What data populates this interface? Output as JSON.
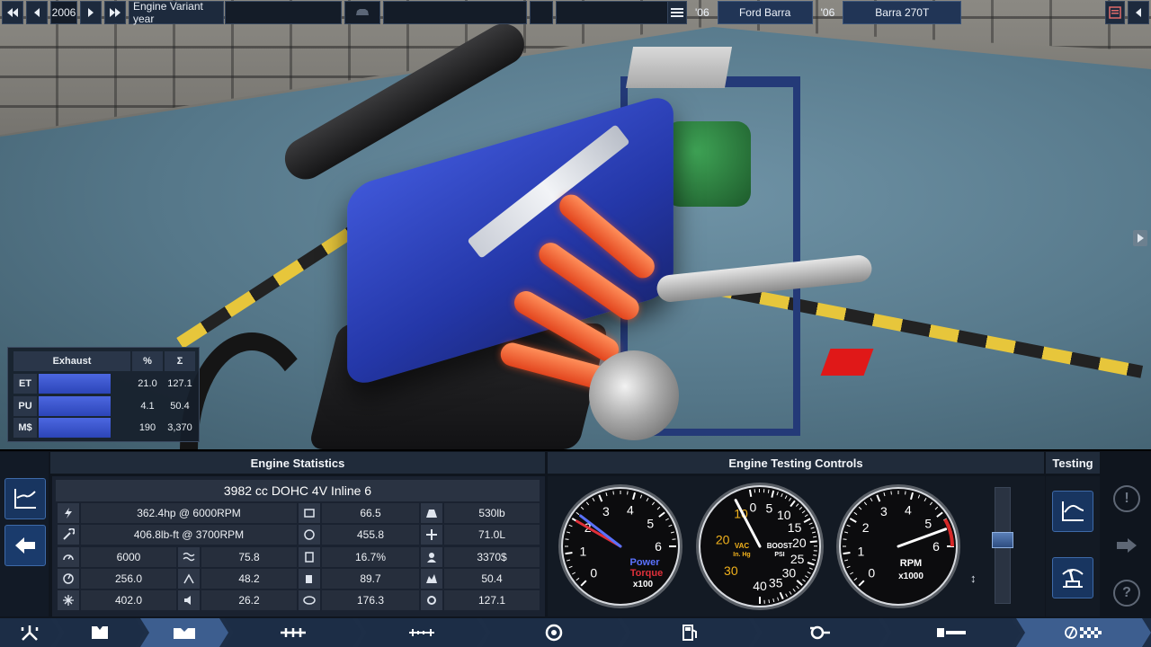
{
  "topbar": {
    "year": "2006",
    "label": "Engine Variant year",
    "model_year": "'06",
    "model_name": "Ford Barra",
    "variant_year": "'06",
    "variant_name": "Barra 270T",
    "icons": [
      "first-icon",
      "prev-icon",
      "next-icon",
      "last-icon",
      "car-icon",
      "list-icon",
      "menu-icon"
    ]
  },
  "exhaust": {
    "title": "Exhaust",
    "col_pct": "%",
    "col_sum": "Σ",
    "rows": [
      {
        "label": "ET",
        "pct": "21.0",
        "sum": "127.1",
        "fill": 1.0
      },
      {
        "label": "PU",
        "pct": "4.1",
        "sum": "50.4",
        "fill": 1.0
      },
      {
        "label": "M$",
        "pct": "190",
        "sum": "3,370",
        "fill": 1.0
      }
    ]
  },
  "stats": {
    "title": "Engine Statistics",
    "engine_desc": "3982 cc DOHC 4V  Inline 6",
    "power": "362.4hp @ 6000RPM",
    "torque": "406.8lb-ft @ 3700RPM",
    "r1": {
      "c1": "66.5",
      "c2": "530lb"
    },
    "r2": {
      "c1": "455.8",
      "c2": "71.0L"
    },
    "r3": {
      "a": "6000",
      "b": "75.8",
      "c1": "16.7%",
      "c2": "3370$"
    },
    "r4": {
      "a": "256.0",
      "b": "48.2",
      "c1": "89.7",
      "c2": "50.4"
    },
    "r5": {
      "a": "402.0",
      "b": "26.2",
      "c1": "176.3",
      "c2": "127.1"
    }
  },
  "testing": {
    "title": "Engine Testing Controls",
    "tab": "Testing",
    "gauge_power": {
      "ticks": [
        "0",
        "1",
        "2",
        "3",
        "4",
        "5",
        "6"
      ],
      "label1": "Power",
      "label2": "Torque",
      "unit": "x100",
      "power_value": 2.2,
      "torque_value": 2.0
    },
    "gauge_boost": {
      "ticks_vac": [
        "10",
        "20",
        "30"
      ],
      "ticks_boost": [
        "0",
        "5",
        "10",
        "15",
        "20",
        "25",
        "30",
        "35",
        "40"
      ],
      "vac_label": "VAC",
      "vac_unit": "In. Hg",
      "boost_label": "BOOST",
      "boost_unit": "PSI",
      "value": 0.5
    },
    "gauge_rpm": {
      "ticks": [
        "0",
        "1",
        "2",
        "3",
        "4",
        "5",
        "6"
      ],
      "label": "RPM",
      "unit": "x1000",
      "value": 6.0
    },
    "throttle": 0.55
  },
  "colors": {
    "accent": "#3d5e8f",
    "power": "#5a72ff",
    "torque": "#e0303a",
    "needle": "#ffffff"
  }
}
